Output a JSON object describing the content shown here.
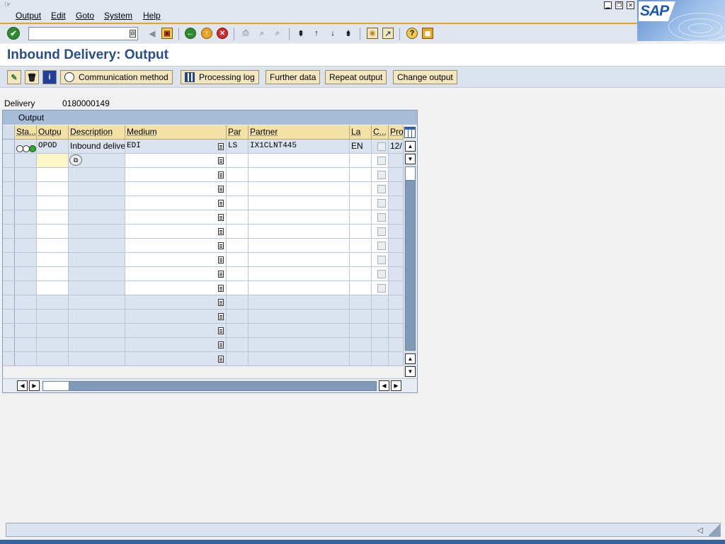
{
  "menu": {
    "items": [
      "Output",
      "Edit",
      "Goto",
      "System",
      "Help"
    ]
  },
  "window_controls": {
    "minimize": "▁",
    "restore": "❐",
    "close": "✕"
  },
  "logo": "SAP",
  "toolbar": {
    "command_value": "",
    "icons": [
      "enter-icon",
      "back-icon",
      "exit-icon",
      "cancel-icon",
      "print-icon",
      "find-icon",
      "find-next-icon",
      "first-page-icon",
      "previous-page-icon",
      "next-page-icon",
      "last-page-icon",
      "create-session-icon",
      "shortcut-icon",
      "help-icon",
      "layout-menu-icon"
    ]
  },
  "title": "Inbound Delivery: Output",
  "app_toolbar": {
    "buttons": [
      "Communication method",
      "Processing log",
      "Further data",
      "Repeat output",
      "Change output"
    ]
  },
  "header": {
    "delivery_label": "Delivery",
    "delivery_number": "0180000149"
  },
  "output_table": {
    "title": "Output",
    "columns": [
      "Sta...",
      "Outpu",
      "Description",
      "Medium",
      "Par",
      "Partner",
      "La",
      "C...",
      "Pro"
    ],
    "rows": [
      {
        "status": "lights",
        "output_type": "OPOD",
        "description": "Inbound delive",
        "medium": "EDI",
        "partner_function": "LS",
        "partner": "IX1CLNT445",
        "language": "EN",
        "changeable": false,
        "processing": "12/"
      }
    ],
    "input_rows": 10,
    "total_rows": 16
  },
  "colors": {
    "accent": "#e8a224",
    "title": "#2a4e86",
    "header_bg": "#f3e1a6",
    "readonly_cell": "#dae3ef",
    "status_green": "#23b321"
  }
}
